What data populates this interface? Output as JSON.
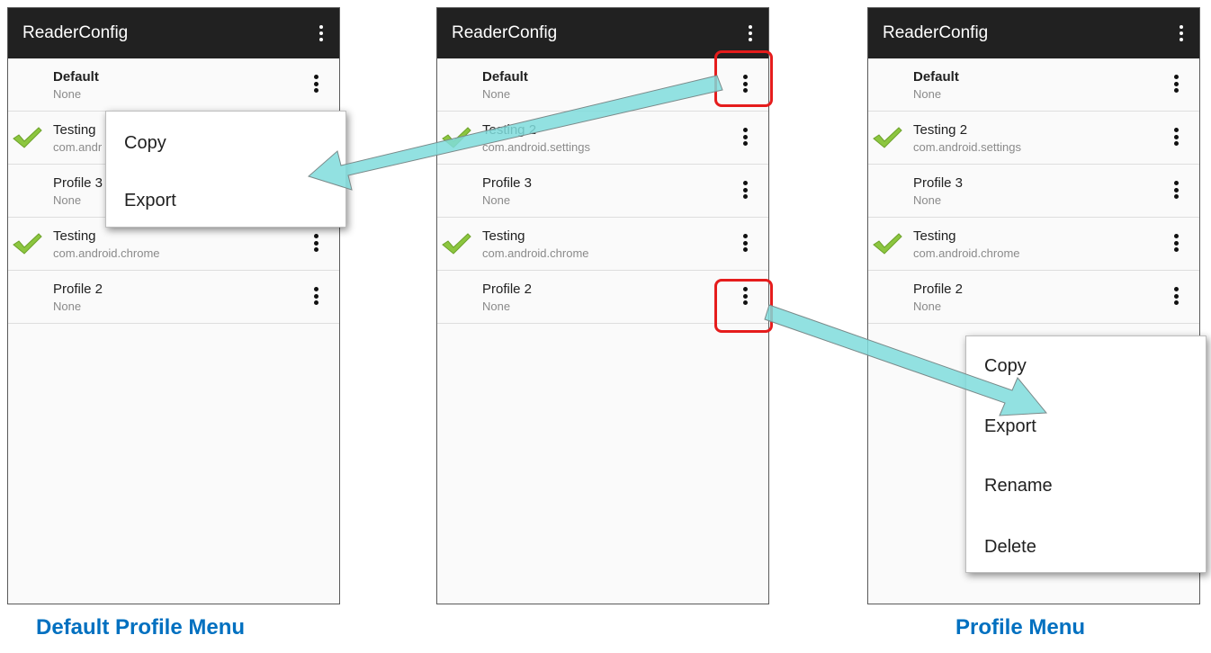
{
  "app_title": "ReaderConfig",
  "profiles": [
    {
      "name": "Default",
      "subtitle": "None",
      "checked": false,
      "bold": true
    },
    {
      "name": "Testing 2",
      "subtitle": "com.android.settings",
      "checked": true,
      "bold": false
    },
    {
      "name": "Profile 3",
      "subtitle": "None",
      "checked": false,
      "bold": false
    },
    {
      "name": "Testing",
      "subtitle": "com.android.chrome",
      "checked": true,
      "bold": false
    },
    {
      "name": "Profile 2",
      "subtitle": "None",
      "checked": false,
      "bold": false
    }
  ],
  "panel1_visible_names": [
    "Default",
    "Testing",
    "Profile 3",
    "Testing",
    "Profile 2"
  ],
  "panel1_visible_subs": [
    "None",
    "com.andr",
    "None",
    "com.android.chrome",
    "None"
  ],
  "default_menu": {
    "items": [
      "Copy",
      "Export"
    ]
  },
  "profile_menu": {
    "items": [
      "Copy",
      "Export",
      "Rename",
      "Delete"
    ]
  },
  "captions": {
    "left": "Default Profile Menu",
    "right": "Profile Menu"
  },
  "colors": {
    "appbar": "#212121",
    "highlight": "#e51c1c",
    "arrow": "#7fdcdc",
    "caption": "#0070c0",
    "check": "#8cc63f"
  },
  "icons": {
    "overflow": "more-vertical-icon",
    "check": "checkmark-icon"
  }
}
